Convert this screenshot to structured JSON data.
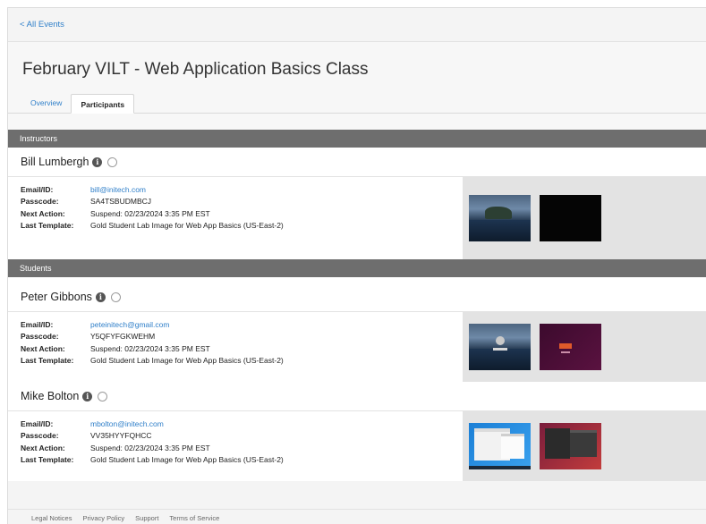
{
  "nav": {
    "back_label": "< All Events"
  },
  "page": {
    "title": "February VILT - Web Application Basics Class"
  },
  "tabs": [
    {
      "label": "Overview",
      "active": false
    },
    {
      "label": "Participants",
      "active": true
    }
  ],
  "labels": {
    "email": "Email/ID:",
    "passcode": "Passcode:",
    "next_action": "Next Action:",
    "last_template": "Last Template:"
  },
  "instructors": {
    "heading": "Instructors",
    "people": [
      {
        "name": "Bill Lumbergh",
        "email": "bill@initech.com",
        "passcode": "SA4TSBUDMBCJ",
        "next_action": "Suspend: 02/23/2024 3:35 PM EST",
        "last_template": "Gold Student Lab Image for Web App Basics (US-East-2)",
        "thumbnails": [
          "landscape-lock-screen",
          "black-screen"
        ]
      }
    ]
  },
  "students": {
    "heading": "Students",
    "people": [
      {
        "name": "Peter Gibbons",
        "email": "peteinitech@gmail.com",
        "passcode": "Y5QFYFGKWEHM",
        "next_action": "Suspend: 02/23/2024 3:35 PM EST",
        "last_template": "Gold Student Lab Image for Web App Basics (US-East-2)",
        "thumbnails": [
          "landscape-login-screen",
          "ubuntu-login-screen"
        ]
      },
      {
        "name": "Mike Bolton",
        "email": "mbolton@initech.com",
        "passcode": "VV35HYYFQHCC",
        "next_action": "Suspend: 02/23/2024 3:35 PM EST",
        "last_template": "Gold Student Lab Image for Web App Basics (US-East-2)",
        "thumbnails": [
          "windows-desktop",
          "linux-desktop"
        ]
      }
    ]
  },
  "footer": {
    "links": [
      "Legal Notices",
      "Privacy Policy",
      "Support",
      "Terms of Service"
    ]
  },
  "colors": {
    "link": "#2f7fc9",
    "section_bar": "#6e6e6e"
  },
  "icons": {
    "info": "info-icon",
    "status": "radio-icon"
  }
}
